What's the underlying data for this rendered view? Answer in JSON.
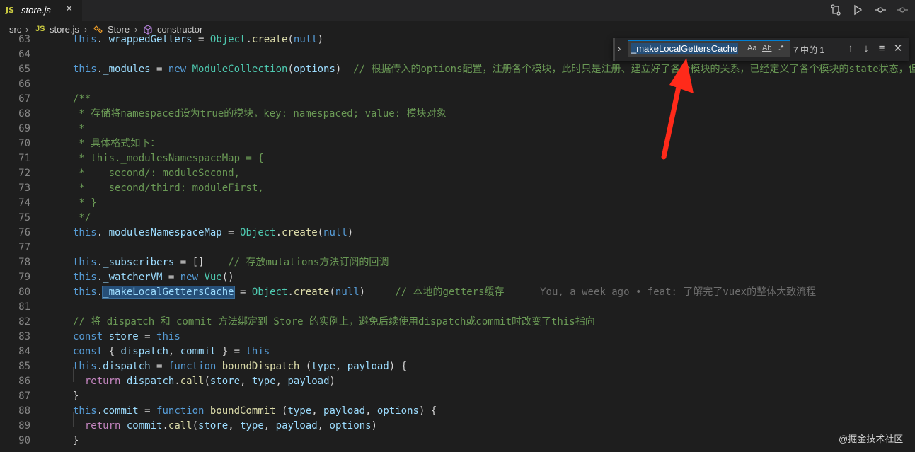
{
  "tab": {
    "lang_badge": "JS",
    "filename": "store.js",
    "close_glyph": "×"
  },
  "toolbar": {
    "icons": [
      "compare-changes-icon",
      "run-icon",
      "source-control-icon",
      "timeline-icon"
    ]
  },
  "breadcrumb": {
    "folder": "src",
    "file_badge": "JS",
    "file": "store.js",
    "class": "Store",
    "method": "constructor"
  },
  "find_widget": {
    "value": "_makeLocalGettersCache",
    "match_case_label": "Aa",
    "whole_word_label": "Ab",
    "regex_label": ".*",
    "result_count": "7 中的 1"
  },
  "code_lines": [
    {
      "no": "63",
      "tokens": [
        [
          "k",
          "this"
        ],
        [
          "p",
          "."
        ],
        [
          "v",
          "_wrappedGetters"
        ],
        [
          "p",
          " = "
        ],
        [
          "t",
          "Object"
        ],
        [
          "p",
          "."
        ],
        [
          "f",
          "create"
        ],
        [
          "p",
          "("
        ],
        [
          "k",
          "null"
        ],
        [
          "p",
          ")"
        ]
      ]
    },
    {
      "no": "64",
      "tokens": []
    },
    {
      "no": "65",
      "tokens": [
        [
          "k",
          "this"
        ],
        [
          "p",
          "."
        ],
        [
          "v",
          "_modules"
        ],
        [
          "p",
          " = "
        ],
        [
          "k",
          "new "
        ],
        [
          "t",
          "ModuleCollection"
        ],
        [
          "p",
          "("
        ],
        [
          "v",
          "options"
        ],
        [
          "p",
          ")  "
        ],
        [
          "c",
          "// 根据传入的options配置，注册各个模块，此时只是注册、建立好了各个模块的关系，已经定义了各个模块的state状态，但"
        ]
      ]
    },
    {
      "no": "66",
      "tokens": []
    },
    {
      "no": "67",
      "tokens": [
        [
          "c",
          "/**"
        ]
      ]
    },
    {
      "no": "68",
      "tokens": [
        [
          "c",
          " * 存储将namespaced设为true的模块，key: namespaced; value: 模块对象"
        ]
      ]
    },
    {
      "no": "69",
      "tokens": [
        [
          "c",
          " *"
        ]
      ]
    },
    {
      "no": "70",
      "tokens": [
        [
          "c",
          " * 具体格式如下："
        ]
      ]
    },
    {
      "no": "71",
      "tokens": [
        [
          "c",
          " * this._modulesNamespaceMap = {"
        ]
      ]
    },
    {
      "no": "72",
      "tokens": [
        [
          "c",
          " *    second/: moduleSecond,"
        ]
      ]
    },
    {
      "no": "73",
      "tokens": [
        [
          "c",
          " *    second/third: moduleFirst,"
        ]
      ]
    },
    {
      "no": "74",
      "tokens": [
        [
          "c",
          " * }"
        ]
      ]
    },
    {
      "no": "75",
      "tokens": [
        [
          "c",
          " */"
        ]
      ]
    },
    {
      "no": "76",
      "tokens": [
        [
          "k",
          "this"
        ],
        [
          "p",
          "."
        ],
        [
          "v",
          "_modulesNamespaceMap"
        ],
        [
          "p",
          " = "
        ],
        [
          "t",
          "Object"
        ],
        [
          "p",
          "."
        ],
        [
          "f",
          "create"
        ],
        [
          "p",
          "("
        ],
        [
          "k",
          "null"
        ],
        [
          "p",
          ")"
        ]
      ]
    },
    {
      "no": "77",
      "tokens": []
    },
    {
      "no": "78",
      "tokens": [
        [
          "k",
          "this"
        ],
        [
          "p",
          "."
        ],
        [
          "v",
          "_subscribers"
        ],
        [
          "p",
          " = []    "
        ],
        [
          "c",
          "// 存放mutations方法订阅的回调"
        ]
      ]
    },
    {
      "no": "79",
      "tokens": [
        [
          "k",
          "this"
        ],
        [
          "p",
          "."
        ],
        [
          "v",
          "_watcherVM"
        ],
        [
          "p",
          " = "
        ],
        [
          "k",
          "new "
        ],
        [
          "t",
          "Vue"
        ],
        [
          "p",
          "()"
        ]
      ]
    },
    {
      "no": "80",
      "tokens": [
        [
          "k",
          "this"
        ],
        [
          "p",
          "."
        ],
        [
          "hl",
          "_makeLocalGettersCache"
        ],
        [
          "p",
          " = "
        ],
        [
          "t",
          "Object"
        ],
        [
          "p",
          "."
        ],
        [
          "f",
          "create"
        ],
        [
          "p",
          "("
        ],
        [
          "k",
          "null"
        ],
        [
          "p",
          ")     "
        ],
        [
          "c",
          "// 本地的getters缓存"
        ],
        [
          "blame",
          "      You, a week ago • feat: 了解完了vuex的整体大致流程"
        ]
      ]
    },
    {
      "no": "81",
      "tokens": []
    },
    {
      "no": "82",
      "tokens": [
        [
          "c",
          "// 将 dispatch 和 commit 方法绑定到 Store 的实例上，避免后续使用dispatch或commit时改变了this指向"
        ]
      ]
    },
    {
      "no": "83",
      "tokens": [
        [
          "k",
          "const "
        ],
        [
          "v",
          "store"
        ],
        [
          "p",
          " = "
        ],
        [
          "k",
          "this"
        ]
      ]
    },
    {
      "no": "84",
      "tokens": [
        [
          "k",
          "const "
        ],
        [
          "p",
          "{ "
        ],
        [
          "v",
          "dispatch"
        ],
        [
          "p",
          ", "
        ],
        [
          "v",
          "commit"
        ],
        [
          "p",
          " } = "
        ],
        [
          "k",
          "this"
        ]
      ]
    },
    {
      "no": "85",
      "tokens": [
        [
          "k",
          "this"
        ],
        [
          "p",
          "."
        ],
        [
          "v",
          "dispatch"
        ],
        [
          "p",
          " = "
        ],
        [
          "k",
          "function "
        ],
        [
          "f",
          "boundDispatch"
        ],
        [
          "p",
          " ("
        ],
        [
          "v",
          "type"
        ],
        [
          "p",
          ", "
        ],
        [
          "v",
          "payload"
        ],
        [
          "p",
          ") {"
        ]
      ]
    },
    {
      "no": "86",
      "tokens": [
        [
          "p",
          "  "
        ],
        [
          "ctl",
          "return "
        ],
        [
          "v",
          "dispatch"
        ],
        [
          "p",
          "."
        ],
        [
          "f",
          "call"
        ],
        [
          "p",
          "("
        ],
        [
          "v",
          "store"
        ],
        [
          "p",
          ", "
        ],
        [
          "v",
          "type"
        ],
        [
          "p",
          ", "
        ],
        [
          "v",
          "payload"
        ],
        [
          "p",
          ")"
        ]
      ]
    },
    {
      "no": "87",
      "tokens": [
        [
          "p",
          "}"
        ]
      ]
    },
    {
      "no": "88",
      "tokens": [
        [
          "k",
          "this"
        ],
        [
          "p",
          "."
        ],
        [
          "v",
          "commit"
        ],
        [
          "p",
          " = "
        ],
        [
          "k",
          "function "
        ],
        [
          "f",
          "boundCommit"
        ],
        [
          "p",
          " ("
        ],
        [
          "v",
          "type"
        ],
        [
          "p",
          ", "
        ],
        [
          "v",
          "payload"
        ],
        [
          "p",
          ", "
        ],
        [
          "v",
          "options"
        ],
        [
          "p",
          ") {"
        ]
      ]
    },
    {
      "no": "89",
      "tokens": [
        [
          "p",
          "  "
        ],
        [
          "ctl",
          "return "
        ],
        [
          "v",
          "commit"
        ],
        [
          "p",
          "."
        ],
        [
          "f",
          "call"
        ],
        [
          "p",
          "("
        ],
        [
          "v",
          "store"
        ],
        [
          "p",
          ", "
        ],
        [
          "v",
          "type"
        ],
        [
          "p",
          ", "
        ],
        [
          "v",
          "payload"
        ],
        [
          "p",
          ", "
        ],
        [
          "v",
          "options"
        ],
        [
          "p",
          ")"
        ]
      ]
    },
    {
      "no": "90",
      "tokens": [
        [
          "p",
          "}"
        ]
      ]
    }
  ],
  "watermark": "@掘金技术社区"
}
